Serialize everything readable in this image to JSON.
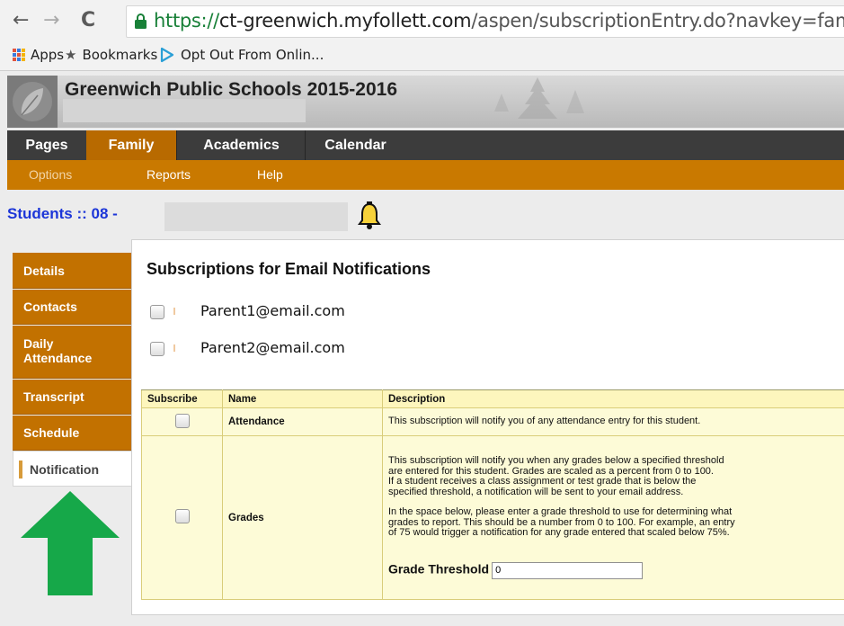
{
  "browser": {
    "url_secure": "https://",
    "url_host": "ct-greenwich.myfollett.com",
    "url_path": "/aspen/subscriptionEntry.do?navkey=family.std.",
    "bookmarks": [
      "Apps",
      "Bookmarks",
      "Opt Out From Onlin..."
    ]
  },
  "app": {
    "title": "Greenwich Public Schools 2015-2016"
  },
  "top_tabs": [
    "Pages",
    "Family",
    "Academics",
    "Calendar"
  ],
  "active_top_tab": "Family",
  "sub_tabs": [
    "Options",
    "Reports",
    "Help"
  ],
  "students_line": "Students :: 08 -",
  "side_tabs": [
    "Details",
    "Contacts",
    "Daily\nAttendance",
    "Transcript",
    "Schedule",
    "Notification"
  ],
  "active_side_tab": "Notification",
  "panel": {
    "title": "Subscriptions for Email Notifications",
    "emails": [
      "Parent1@email.com",
      "Parent2@email.com"
    ],
    "table": {
      "headers": [
        "Subscribe",
        "Name",
        "Description"
      ],
      "rows": [
        {
          "name": "Attendance",
          "description": "This subscription will notify you of any attendance entry for this student."
        },
        {
          "name": "Grades",
          "description_lines": [
            "This subscription will notify you when any grades below a specified threshold",
            "are entered for this student. Grades are scaled as a percent from 0 to 100.",
            "If a student receives a class assignment or test grade that is below the",
            "specified threshold, a notification will be sent to your email address.",
            "",
            "In the space below, please enter a grade threshold to use for determining what",
            "grades to report. This should be a number from 0 to 100. For example, an entry",
            "of 75 would trigger a notification for any grade entered that scaled below 75%."
          ],
          "threshold_label": "Grade Threshold",
          "threshold_value": "0"
        }
      ]
    }
  },
  "colors": {
    "accent_orange": "#c97900",
    "active_tab": "#b86a00",
    "link_blue": "#1c36d8",
    "arrow_green": "#16a849",
    "table_bg": "#fdfbd7"
  },
  "icons": [
    "back-arrow-icon",
    "forward-arrow-icon",
    "reload-icon",
    "lock-icon",
    "apps-grid-icon",
    "star-icon",
    "play-logo-icon",
    "bell-icon",
    "up-arrow-icon"
  ]
}
